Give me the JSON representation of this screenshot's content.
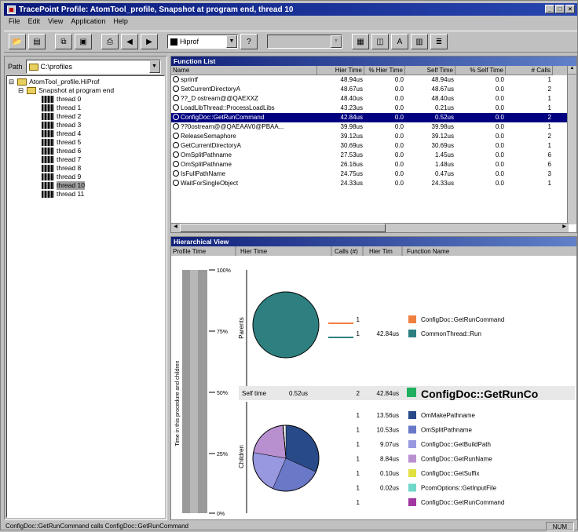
{
  "title": "TracePoint Profile: AtomTool_profile, Snapshot at program end, thread 10",
  "menu": [
    "File",
    "Edit",
    "View",
    "Application",
    "Help"
  ],
  "toolbar": {
    "view_combo": "Hiprof",
    "disabled_combo": ""
  },
  "left": {
    "path_label": "Path",
    "path_value": "C:\\profiles",
    "tree": [
      {
        "label": "AtomTool_profile.HiProf",
        "level": 0,
        "type": "folder",
        "expand": "minus"
      },
      {
        "label": "Snapshot at program end",
        "level": 1,
        "type": "folder",
        "expand": "minus"
      },
      {
        "label": "thread 0",
        "level": 2,
        "type": "thread"
      },
      {
        "label": "thread 1",
        "level": 2,
        "type": "thread"
      },
      {
        "label": "thread 2",
        "level": 2,
        "type": "thread"
      },
      {
        "label": "thread 3",
        "level": 2,
        "type": "thread"
      },
      {
        "label": "thread 4",
        "level": 2,
        "type": "thread"
      },
      {
        "label": "thread 5",
        "level": 2,
        "type": "thread"
      },
      {
        "label": "thread 6",
        "level": 2,
        "type": "thread"
      },
      {
        "label": "thread 7",
        "level": 2,
        "type": "thread"
      },
      {
        "label": "thread 8",
        "level": 2,
        "type": "thread"
      },
      {
        "label": "thread 9",
        "level": 2,
        "type": "thread"
      },
      {
        "label": "thread 10",
        "level": 2,
        "type": "thread",
        "selected": true
      },
      {
        "label": "thread 11",
        "level": 2,
        "type": "thread"
      }
    ]
  },
  "function_list": {
    "title": "Function List",
    "columns": [
      "Name",
      "Hier Time",
      "% Hier Time",
      "Self Time",
      "% Self Time",
      "# Calls"
    ],
    "rows": [
      [
        "sprintf",
        "48.94us",
        "0.0",
        "48.94us",
        "0.0",
        "1"
      ],
      [
        "SetCurrentDirectoryA",
        "48.67us",
        "0.0",
        "48.67us",
        "0.0",
        "2"
      ],
      [
        "??_D ostream@@QAEXXZ",
        "48.40us",
        "0.0",
        "48.40us",
        "0.0",
        "1"
      ],
      [
        "LoadLibThread::ProcessLoadLibs",
        "43.23us",
        "0.0",
        "0.21us",
        "0.0",
        "1"
      ],
      [
        "ConfigDoc::GetRunCommand",
        "42.84us",
        "0.0",
        "0.52us",
        "0.0",
        "2"
      ],
      [
        "??0ostream@@QAEAAV0@PBAA...",
        "39.98us",
        "0.0",
        "39.98us",
        "0.0",
        "1"
      ],
      [
        "ReleaseSemaphore",
        "39.12us",
        "0.0",
        "39.12us",
        "0.0",
        "2"
      ],
      [
        "GetCurrentDirectoryA",
        "30.69us",
        "0.0",
        "30.69us",
        "0.0",
        "1"
      ],
      [
        "OmSplitPathname",
        "27.53us",
        "0.0",
        "1.45us",
        "0.0",
        "6"
      ],
      [
        "OmSplitPathname",
        "26.16us",
        "0.0",
        "1.48us",
        "0.0",
        "6"
      ],
      [
        "IsFullPathName",
        "24.75us",
        "0.0",
        "0.47us",
        "0.0",
        "3"
      ],
      [
        "WaitForSingleObject",
        "24.33us",
        "0.0",
        "24.33us",
        "0.0",
        "1"
      ]
    ],
    "selected_row": 4
  },
  "hier": {
    "title": "Hierarchical View",
    "columns": [
      "Profile Time",
      "Hier Time",
      "Calls (#)",
      "Hier Tim",
      "Function Name"
    ],
    "y_ticks": [
      "100%",
      "75%",
      "50%",
      "25%",
      "0%"
    ],
    "axis_label": "Time in this procedure and children",
    "parents_label": "Parents",
    "children_label": "Children",
    "self_label": "Self time",
    "self_value": "0.52us",
    "current_calls": "2",
    "current_time": "42.84us",
    "current_name": "ConfigDoc::GetRunCo",
    "parents": [
      {
        "calls": "1",
        "time": "",
        "name": "ConfigDoc::GetRunCommand",
        "color": "#f08040"
      },
      {
        "calls": "1",
        "time": "42.84us",
        "name": "CommonThread::Run",
        "color": "#2e8080"
      }
    ],
    "children": [
      {
        "calls": "1",
        "time": "13.56us",
        "name": "OmMakePathname",
        "color": "#284a88"
      },
      {
        "calls": "1",
        "time": "10.53us",
        "name": "OmSplitPathname",
        "color": "#6a78c8"
      },
      {
        "calls": "1",
        "time": "9.07us",
        "name": "ConfigDoc::GetBuildPath",
        "color": "#9898e0"
      },
      {
        "calls": "1",
        "time": "8.84us",
        "name": "ConfigDoc::GetRunName",
        "color": "#b890d0"
      },
      {
        "calls": "1",
        "time": "0.10us",
        "name": "ConfigDoc::GetSuffix",
        "color": "#e0e040"
      },
      {
        "calls": "1",
        "time": "0.02us",
        "name": "PcomOptions::GetInputFile",
        "color": "#70d8c8"
      },
      {
        "calls": "1",
        "time": "",
        "name": "ConfigDoc::GetRunCommand",
        "color": "#a038a0"
      }
    ],
    "pie_child_values": [
      13.56,
      10.53,
      9.07,
      8.84,
      0.1,
      0.02
    ]
  },
  "status": {
    "text": "ConfigDoc::GetRunCommand calls ConfigDoc::GetRunCommand",
    "num": "NUM"
  }
}
